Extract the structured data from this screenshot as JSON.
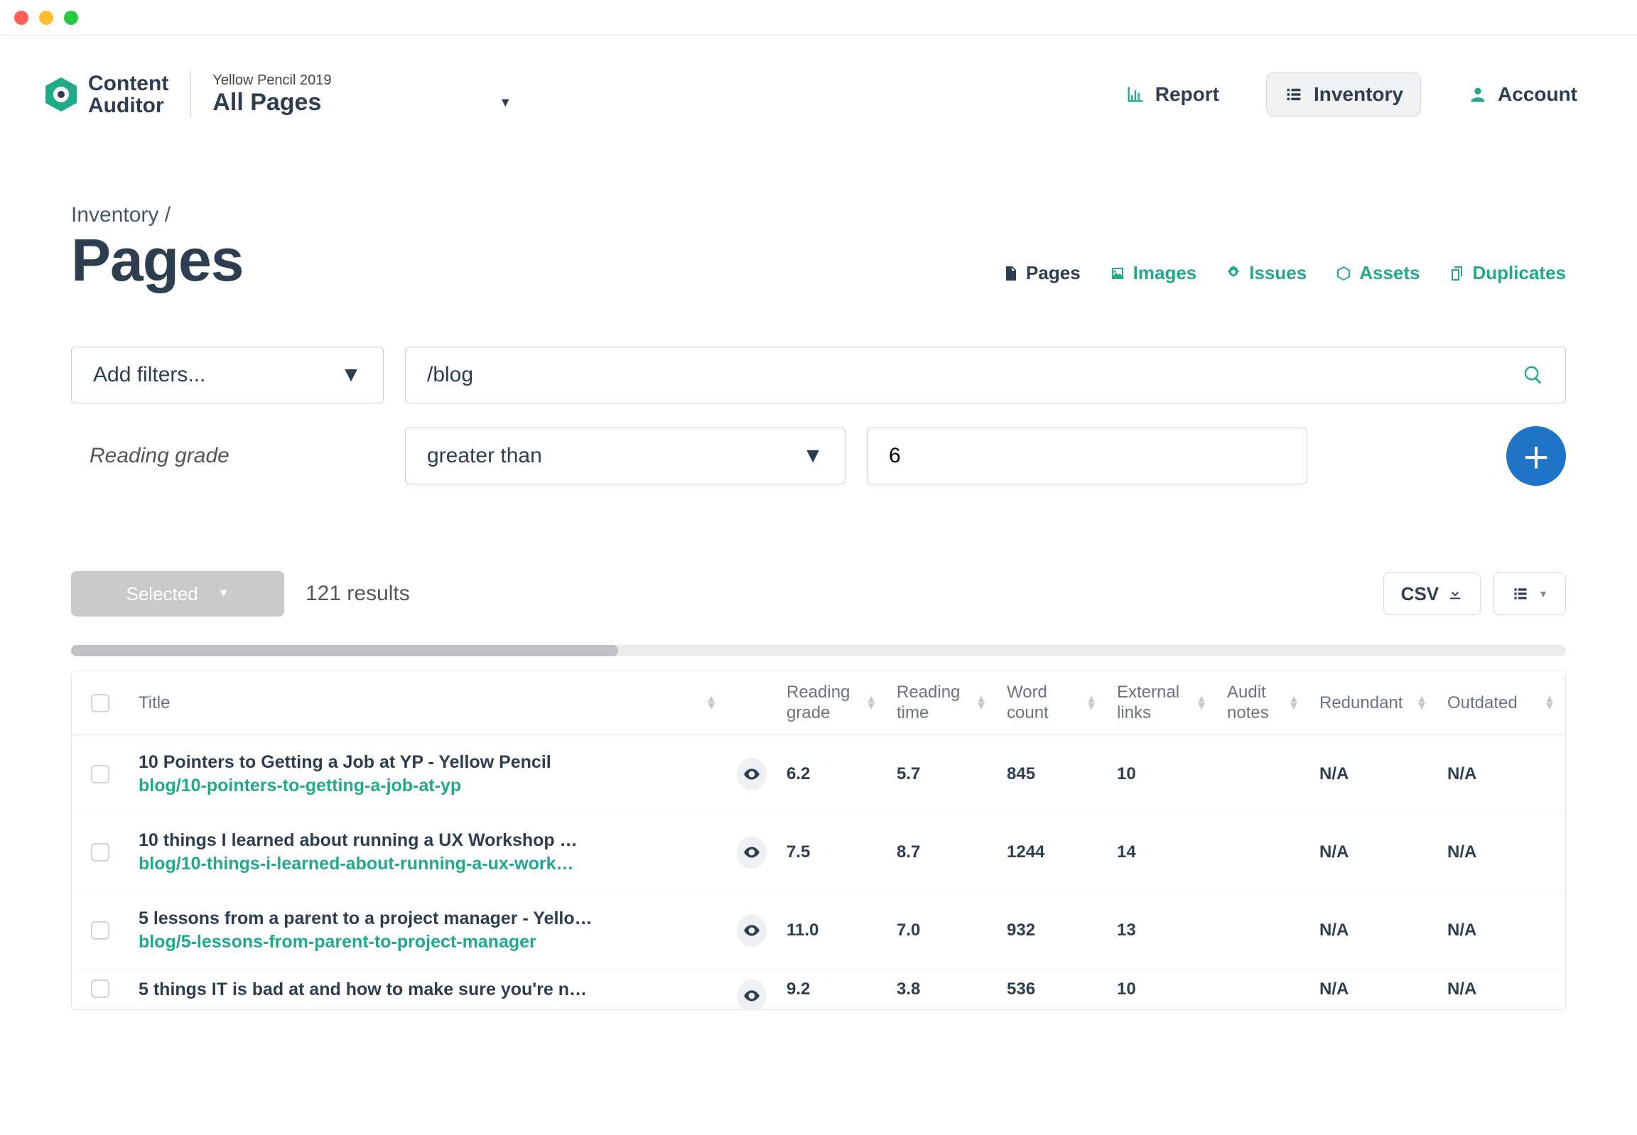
{
  "brand": {
    "line1": "Content",
    "line2": "Auditor"
  },
  "breadcrumb_project": "Yellow Pencil 2019",
  "breadcrumb_scope": "All Pages",
  "nav": {
    "report": "Report",
    "inventory": "Inventory",
    "account": "Account"
  },
  "page": {
    "breadcrumb": "Inventory /",
    "title": "Pages"
  },
  "tabs": {
    "pages": "Pages",
    "images": "Images",
    "issues": "Issues",
    "assets": "Assets",
    "duplicates": "Duplicates"
  },
  "filters": {
    "add_label": "Add filters...",
    "search_value": "/blog",
    "filter_label": "Reading grade",
    "operator": "greater than",
    "value": "6"
  },
  "toolbar": {
    "selected": "Selected",
    "results": "121 results",
    "csv": "CSV"
  },
  "columns": {
    "title": "Title",
    "reading_grade": "Reading grade",
    "reading_time": "Reading time",
    "word_count": "Word count",
    "external_links": "External links",
    "audit_notes": "Audit notes",
    "redundant": "Redundant",
    "outdated": "Outdated"
  },
  "rows": [
    {
      "title": "10 Pointers to Getting a Job at YP - Yellow Pencil",
      "url": "blog/10-pointers-to-getting-a-job-at-yp",
      "reading_grade": "6.2",
      "reading_time": "5.7",
      "word_count": "845",
      "external_links": "10",
      "audit_notes": "",
      "redundant": "N/A",
      "outdated": "N/A"
    },
    {
      "title": "10 things I learned about running a UX Workshop …",
      "url": "blog/10-things-i-learned-about-running-a-ux-work…",
      "reading_grade": "7.5",
      "reading_time": "8.7",
      "word_count": "1244",
      "external_links": "14",
      "audit_notes": "",
      "redundant": "N/A",
      "outdated": "N/A"
    },
    {
      "title": "5 lessons from a parent to a project manager - Yello…",
      "url": "blog/5-lessons-from-parent-to-project-manager",
      "reading_grade": "11.0",
      "reading_time": "7.0",
      "word_count": "932",
      "external_links": "13",
      "audit_notes": "",
      "redundant": "N/A",
      "outdated": "N/A"
    },
    {
      "title": "5 things IT is bad at and how to make sure you're n…",
      "url": "",
      "reading_grade": "9.2",
      "reading_time": "3.8",
      "word_count": "536",
      "external_links": "10",
      "audit_notes": "",
      "redundant": "N/A",
      "outdated": "N/A"
    }
  ],
  "colors": {
    "teal": "#1faa8a",
    "blue": "#1f74c7",
    "dark": "#2c3e50"
  }
}
